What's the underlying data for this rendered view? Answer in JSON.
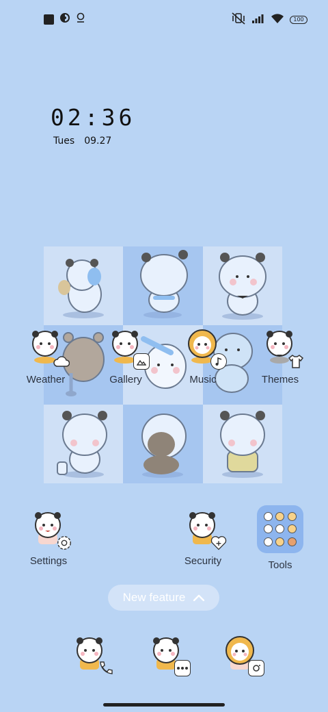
{
  "status_bar": {
    "battery": "100"
  },
  "clock": {
    "time": "02:36",
    "day": "Tues",
    "date": "09.27"
  },
  "apps": {
    "weather": "Weather",
    "gallery": "Gallery",
    "music": "Music",
    "themes": "Themes",
    "settings": "Settings",
    "security": "Security",
    "tools": "Tools"
  },
  "new_feature": {
    "label": "New feature"
  },
  "colors": {
    "background": "#b9d4f4",
    "widget_light": "#cfe0f6",
    "widget_dark": "#a6c6f0",
    "folder": "#8db5ee"
  }
}
